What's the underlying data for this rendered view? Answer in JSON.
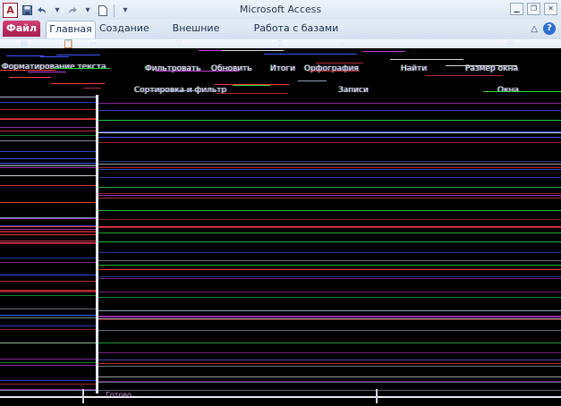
{
  "window": {
    "title": "Microsoft Access"
  },
  "qat": {
    "app_icon_letter": "A",
    "icons": [
      "save-icon",
      "undo-icon",
      "redo-icon",
      "new-document-icon",
      "customize-dropdown-icon"
    ]
  },
  "window_controls": [
    "minimize-icon",
    "restore-icon",
    "close-icon"
  ],
  "tabs": {
    "file": "Файл",
    "items": [
      {
        "label": "Главная",
        "active": true
      },
      {
        "label": "Создание",
        "active": false
      },
      {
        "label": "Внешние данные",
        "active": false
      },
      {
        "label": "Работа с базами данных",
        "active": false
      }
    ],
    "help_icon": "?"
  },
  "ribbon_fragments": [
    "Фильтровать",
    "Обновить",
    "Итоги",
    "Орфография",
    "Найти",
    "Размер окна",
    "Сортировка и фильтр",
    "Форматирование текста",
    "Записи",
    "Окна"
  ],
  "colors": {
    "file_tab": "#b8275a",
    "ribbon_bg": "#e4ebf5",
    "accent_blue": "#2f6fd1",
    "screen_bg": "#000000"
  },
  "status": {
    "text": "Готово"
  }
}
